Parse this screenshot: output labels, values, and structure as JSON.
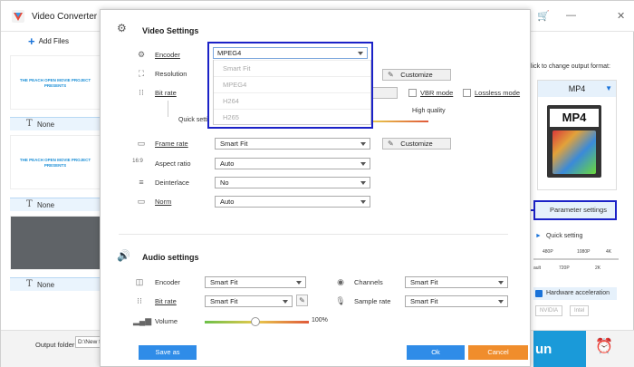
{
  "app": {
    "title": "Video Converter",
    "add_files_label": "Add Files",
    "thumbnails": [
      {
        "text": "THE PEACH OPEN MOVIE PROJECT PRESENTS",
        "subtitle_label": "None"
      },
      {
        "text": "THE PEACH OPEN MOVIE PROJECT PRESENTS",
        "subtitle_label": "None"
      },
      {
        "text": "",
        "subtitle_label": "None"
      }
    ],
    "output_folder_label": "Output folder:",
    "output_folder_value": "D:\\New fo"
  },
  "right_panel": {
    "hint": "lick to change output format:",
    "format_name": "MP4",
    "format_badge": "MP4",
    "parameter_settings_label": "Parameter settings",
    "quick_setting_label": "Quick setting",
    "res_top": [
      "480P",
      "1080P",
      "4K"
    ],
    "res_bottom": [
      "ault",
      "720P",
      "2K"
    ],
    "hw_accel_label": "Hardware acceleration",
    "gpu_labels": [
      "NVIDIA",
      "Intel"
    ],
    "run_label": "un"
  },
  "dialog": {
    "video_settings_title": "Video Settings",
    "audio_settings_title": "Audio settings",
    "video": {
      "encoder_label": "Encoder",
      "resolution_label": "Resolution",
      "bitrate_label": "Bit rate",
      "quick_setting_label": "Quick setting",
      "high_quality_label": "High quality",
      "vbr_label": "VBR mode",
      "lossless_label": "Lossless mode",
      "bitrate_partial_label": "ize",
      "customize_label": "Customize",
      "framerate_label": "Frame rate",
      "framerate_value": "Smart Fit",
      "aspect_label": "Aspect ratio",
      "aspect_value": "Auto",
      "deinterlace_label": "Deinterlace",
      "deinterlace_value": "No",
      "norm_label": "Norm",
      "norm_value": "Auto"
    },
    "encoder_dropdown": {
      "current": "MPEG4",
      "options": [
        "Smart Fit",
        "MPEG4",
        "H264",
        "H265"
      ]
    },
    "audio": {
      "encoder_label": "Encoder",
      "encoder_value": "Smart Fit",
      "bitrate_label": "Bit rate",
      "bitrate_value": "Smart Fit",
      "volume_label": "Volume",
      "volume_value": "100%",
      "volume_level": 0.45,
      "channels_label": "Channels",
      "channels_value": "Smart Fit",
      "samplerate_label": "Sample rate",
      "samplerate_value": "Smart Fit"
    },
    "save_as_label": "Save as",
    "ok_label": "Ok",
    "cancel_label": "Cancel"
  },
  "colors": {
    "accent": "#2f8ce8",
    "highlight": "#1b22c7",
    "cancel": "#f08d2c"
  }
}
